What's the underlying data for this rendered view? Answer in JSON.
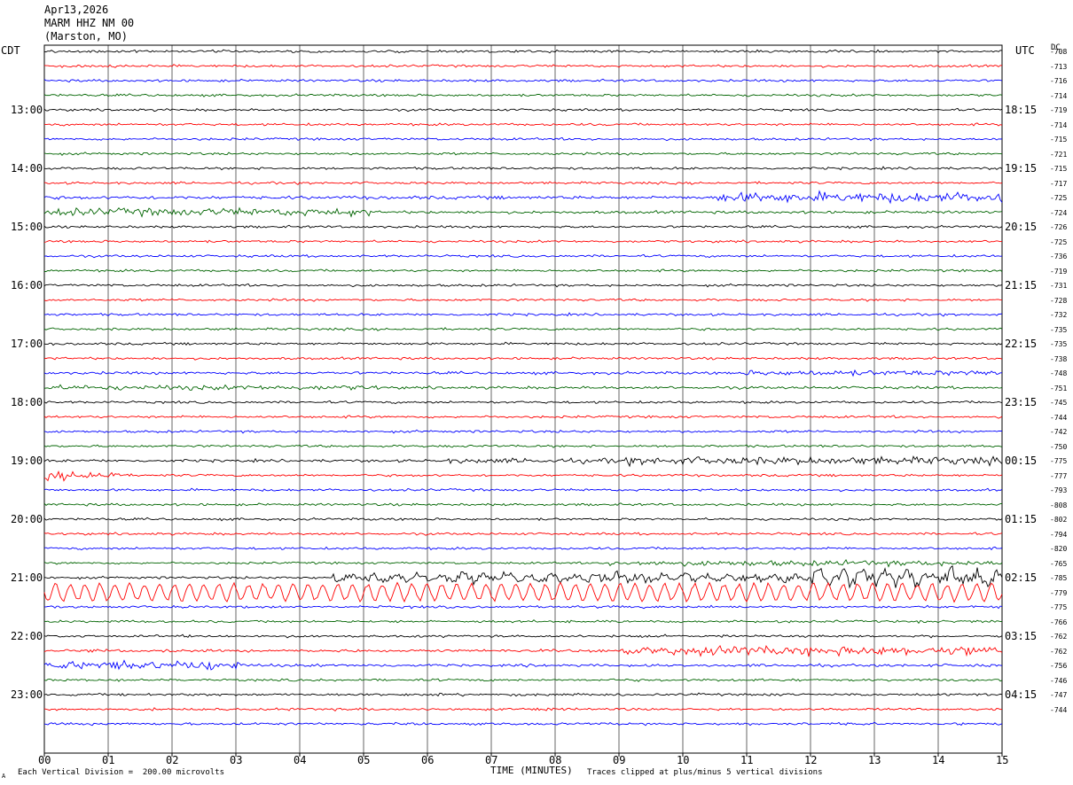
{
  "header": {
    "date": "Apr13,2026",
    "station": "MARM HHZ NM 00",
    "location": "(Marston, MO)"
  },
  "left_timezone": "CDT",
  "right_timezone": "UTC",
  "dc_label": "DC",
  "footer": {
    "scale": "Each Vertical Division =  200.00 microvolts",
    "clip_note": "Traces clipped at plus/minus 5 vertical divisions",
    "corner_mark": "A"
  },
  "colors": [
    "#000000",
    "#ff0000",
    "#0000ff",
    "#006400"
  ],
  "chart_data": {
    "type": "line",
    "title": "",
    "xlabel": "TIME (MINUTES)",
    "xlim": [
      0,
      15
    ],
    "x_ticks": [
      "00",
      "01",
      "02",
      "03",
      "04",
      "05",
      "06",
      "07",
      "08",
      "09",
      "10",
      "11",
      "12",
      "13",
      "14",
      "15"
    ],
    "left_hour_labels": [
      "13:00",
      "14:00",
      "15:00",
      "16:00",
      "17:00",
      "18:00",
      "19:00",
      "20:00",
      "21:00",
      "22:00",
      "23:00"
    ],
    "right_hour_labels": [
      "18:15",
      "19:15",
      "20:15",
      "21:15",
      "22:15",
      "23:15",
      "00:15",
      "01:15",
      "02:15",
      "03:15",
      "04:15"
    ],
    "dc_offsets": [
      -708,
      -713,
      -716,
      -714,
      -719,
      -714,
      -715,
      -721,
      -715,
      -717,
      -725,
      -724,
      -726,
      -725,
      -736,
      -719,
      -731,
      -728,
      -732,
      -735,
      -735,
      -738,
      -748,
      -751,
      -745,
      -744,
      -742,
      -750,
      -775,
      -777,
      -793,
      -808,
      -802,
      -794,
      -820,
      -765,
      -785,
      -779,
      -775,
      -766,
      -762,
      -762,
      -756,
      -746,
      -747,
      -744
    ],
    "trace_rows": 48,
    "minutes_per_row": 15,
    "activity_notes": "amplitude envelope per row; rows 11-12 elevated, rows 36-37 strong oscillation, rows 41 late activity"
  }
}
